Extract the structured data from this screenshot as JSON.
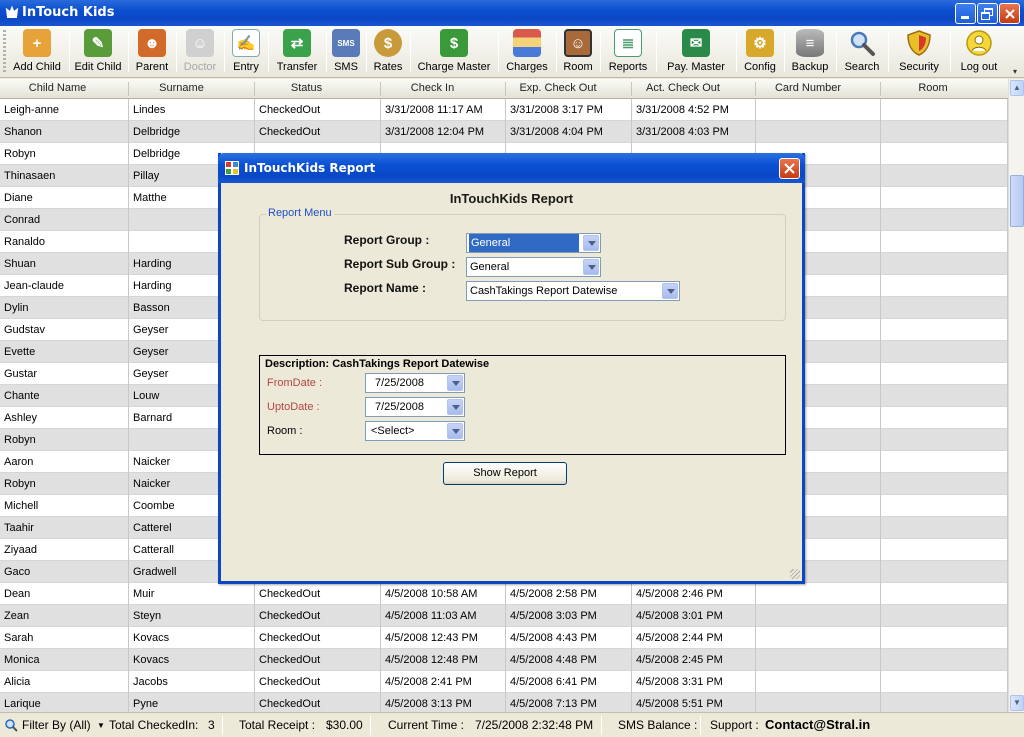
{
  "window": {
    "title": "InTouch Kids"
  },
  "toolbar": {
    "buttons": [
      {
        "label": "Add Child",
        "icon": "add-child-icon",
        "color": "#e8a23a"
      },
      {
        "label": "Edit Child",
        "icon": "edit-child-icon",
        "color": "#5a9c3a"
      },
      {
        "label": "Parent",
        "icon": "parent-icon",
        "color": "#d26a2a"
      },
      {
        "label": "Doctor",
        "icon": "doctor-icon",
        "color": "#c8c8c8"
      },
      {
        "label": "Entry",
        "icon": "entry-icon",
        "color": "#7fa8d8"
      },
      {
        "label": "Transfer",
        "icon": "transfer-icon",
        "color": "#3aa24a"
      },
      {
        "label": "SMS",
        "icon": "sms-icon",
        "color": "#5a7ab8"
      },
      {
        "label": "Rates",
        "icon": "rates-icon",
        "color": "#c89a3a"
      },
      {
        "label": "Charge Master",
        "icon": "charge-master-icon",
        "color": "#3a9a3a"
      },
      {
        "label": "Charges",
        "icon": "charges-icon",
        "color": "#d8a84a"
      },
      {
        "label": "Room",
        "icon": "room-icon",
        "color": "#a86a3a"
      },
      {
        "label": "Reports",
        "icon": "reports-icon",
        "color": "#4a9a6a"
      },
      {
        "label": "Pay. Master",
        "icon": "pay-master-icon",
        "color": "#2a8a4a"
      },
      {
        "label": "Config",
        "icon": "config-icon",
        "color": "#d8a82a"
      },
      {
        "label": "Backup",
        "icon": "backup-icon",
        "color": "#8a8a8a"
      },
      {
        "label": "Search",
        "icon": "search-icon",
        "color": "#4a7ab8"
      },
      {
        "label": "Security",
        "icon": "security-icon",
        "color": "#d8b82a"
      },
      {
        "label": "Log out",
        "icon": "logout-icon",
        "color": "#e8c82a"
      }
    ]
  },
  "grid": {
    "columns": [
      "Child Name",
      "Surname",
      "Status",
      "Check In",
      "Exp. Check Out",
      "Act. Check Out",
      "Card Number",
      "Room"
    ],
    "rows": [
      [
        "Leigh-anne",
        "Lindes",
        "CheckedOut",
        "3/31/2008 11:17 AM",
        "3/31/2008 3:17 PM",
        "3/31/2008 4:52 PM",
        "",
        ""
      ],
      [
        "Shanon",
        "Delbridge",
        "CheckedOut",
        "3/31/2008 12:04 PM",
        "3/31/2008 4:04 PM",
        "3/31/2008 4:03 PM",
        "",
        ""
      ],
      [
        "Robyn",
        "Delbridge",
        "",
        "",
        "",
        "",
        "",
        ""
      ],
      [
        "Thinasaen",
        "Pillay",
        "",
        "",
        "",
        "",
        "",
        ""
      ],
      [
        "Diane",
        "Matthe",
        "",
        "",
        "",
        "",
        "",
        ""
      ],
      [
        "Conrad",
        "",
        "",
        "",
        "",
        "",
        "",
        ""
      ],
      [
        "Ranaldo",
        "",
        "",
        "",
        "",
        "",
        "",
        ""
      ],
      [
        "Shuan",
        "Harding",
        "",
        "",
        "",
        "",
        "",
        ""
      ],
      [
        "Jean-claude",
        "Harding",
        "",
        "",
        "",
        "",
        "",
        ""
      ],
      [
        "Dylin",
        "Basson",
        "",
        "",
        "",
        "",
        "",
        ""
      ],
      [
        "Gudstav",
        "Geyser",
        "",
        "",
        "",
        "",
        "",
        ""
      ],
      [
        "Evette",
        "Geyser",
        "",
        "",
        "",
        "",
        "",
        ""
      ],
      [
        "Gustar",
        "Geyser",
        "",
        "",
        "",
        "",
        "",
        ""
      ],
      [
        "Chante",
        "Louw",
        "",
        "",
        "",
        "",
        "",
        ""
      ],
      [
        "Ashley",
        "Barnard",
        "",
        "",
        "",
        "",
        "",
        ""
      ],
      [
        "Robyn",
        "",
        "",
        "",
        "",
        "",
        "",
        ""
      ],
      [
        "Aaron",
        "Naicker",
        "",
        "",
        "",
        "",
        "",
        ""
      ],
      [
        "Robyn",
        "Naicker",
        "",
        "",
        "",
        "",
        "",
        ""
      ],
      [
        "Michell",
        "Coombe",
        "",
        "",
        "",
        "",
        "",
        ""
      ],
      [
        "Taahir",
        "Catterel",
        "",
        "",
        "",
        "",
        "",
        ""
      ],
      [
        "Ziyaad",
        "Catterall",
        "",
        "",
        "",
        "",
        "",
        ""
      ],
      [
        "Gaco",
        "Gradwell",
        "",
        "",
        "",
        "",
        "",
        ""
      ],
      [
        "Dean",
        "Muir",
        "CheckedOut",
        "4/5/2008 10:58 AM",
        "4/5/2008 2:58 PM",
        "4/5/2008 2:46 PM",
        "",
        ""
      ],
      [
        "Zean",
        "Steyn",
        "CheckedOut",
        "4/5/2008 11:03 AM",
        "4/5/2008 3:03 PM",
        "4/5/2008 3:01 PM",
        "",
        ""
      ],
      [
        "Sarah",
        "Kovacs",
        "CheckedOut",
        "4/5/2008 12:43 PM",
        "4/5/2008 4:43 PM",
        "4/5/2008 2:44 PM",
        "",
        ""
      ],
      [
        "Monica",
        "Kovacs",
        "CheckedOut",
        "4/5/2008 12:48 PM",
        "4/5/2008 4:48 PM",
        "4/5/2008 2:45 PM",
        "",
        ""
      ],
      [
        "Alicia",
        "Jacobs",
        "CheckedOut",
        "4/5/2008 2:41 PM",
        "4/5/2008 6:41 PM",
        "4/5/2008 3:31 PM",
        "",
        ""
      ],
      [
        "Larique",
        "Pyne",
        "CheckedOut",
        "4/5/2008 3:13 PM",
        "4/5/2008 7:13 PM",
        "4/5/2008 5:51 PM",
        "",
        ""
      ]
    ]
  },
  "statusbar": {
    "filter": "Filter By (All)",
    "total_checkedin_label": "Total CheckedIn:",
    "total_checkedin_value": "3",
    "total_receipt_label": "Total Receipt :",
    "total_receipt_value": "$30.00",
    "current_time_label": "Current Time :",
    "current_time_value": "7/25/2008 2:32:48 PM",
    "sms_balance_label": "SMS Balance :",
    "support_label": "Support :",
    "support_value": "Contact@Stral.in"
  },
  "dialog": {
    "title": "InTouchKids Report",
    "heading": "InTouchKids Report",
    "report_menu_legend": "Report Menu",
    "report_group_label": "Report Group :",
    "report_group_value": "General",
    "report_subgroup_label": "Report Sub Group :",
    "report_subgroup_value": "General",
    "report_name_label": "Report Name :",
    "report_name_value": "CashTakings Report Datewise",
    "description_title": "Description: CashTakings Report Datewise",
    "from_date_label": "FromDate :",
    "from_date_value": "7/25/2008",
    "upto_date_label": "UptoDate :",
    "upto_date_value": "7/25/2008",
    "room_label": "Room :",
    "room_value": "<Select>",
    "show_report_label": "Show Report"
  }
}
